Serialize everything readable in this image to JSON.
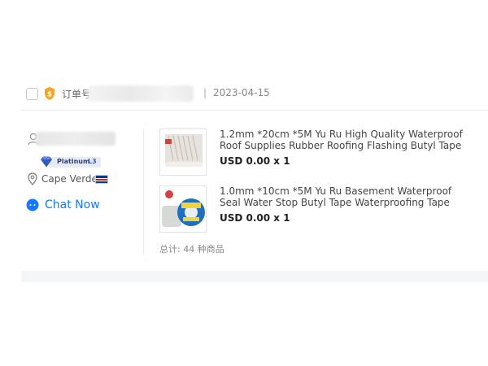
{
  "order": {
    "label": "订单号",
    "separator": "|",
    "date": "2023-04-15"
  },
  "seller": {
    "badge_tier": "Platinum",
    "badge_level": "L3",
    "location": "Cape Verde",
    "chat_label": "Chat Now"
  },
  "products": [
    {
      "title": "1.2mm *20cm *5M Yu Ru High Quality Waterproof Roof Supplies Rubber Roofing Flashing Butyl Tape",
      "price": "USD 0.00 x 1"
    },
    {
      "title": "1.0mm *10cm *5M Yu Ru Basement Waterproof Seal Water Stop Butyl Tape Waterproofing Tape",
      "price": "USD 0.00 x 1"
    }
  ],
  "summary": {
    "total_text": "总计: 44 种商品"
  },
  "colors": {
    "accent": "#1677ff",
    "badge_bg": "#e6ebf7",
    "badge_text": "#2d3e72",
    "icon_orange": "#f5a623"
  }
}
